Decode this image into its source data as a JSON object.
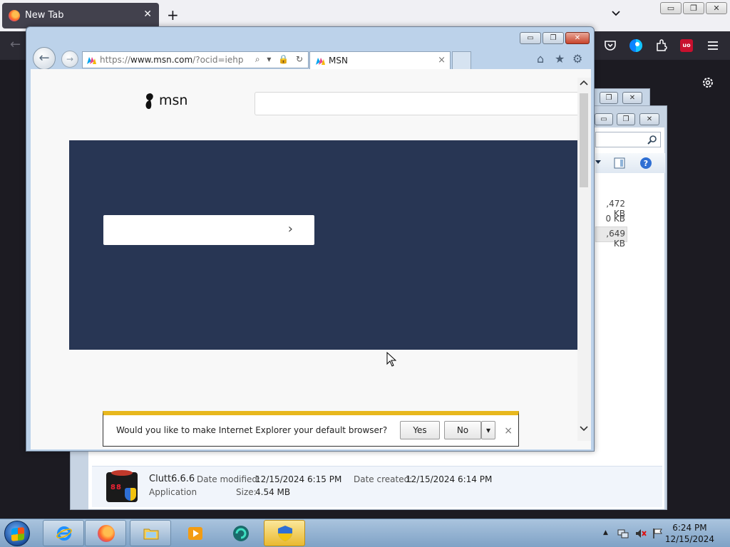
{
  "firefox": {
    "tab_title": "New Tab",
    "tab_close": "✕",
    "new_tab": "+",
    "list_all_tabs": "⌄",
    "window_controls": [
      "▭",
      "❐",
      "✕"
    ],
    "back": "←",
    "ext_label": "uo"
  },
  "ie": {
    "window_controls": [
      "▭",
      "❐",
      "✕"
    ],
    "address_prefix": "https://",
    "address_host": "www.msn.com",
    "address_path": "/?ocid=iehp",
    "address_tools": "⌕ ▾ 🔒 ↻",
    "tab_title": "MSN",
    "tab_close": "×",
    "back": "←",
    "forward": "→",
    "home": "⌂",
    "favorites": "★",
    "tools": "⚙",
    "page": {
      "logo_text": "msn",
      "hero_chevron": "›"
    },
    "notification": {
      "message": "Would you like to make Internet Explorer your default browser?",
      "yes": "Yes",
      "no": "No",
      "dropdown": "▾",
      "close": "×"
    }
  },
  "explorer": {
    "sizes": [
      ",472 KB",
      "0 KB",
      ",649 KB"
    ],
    "file": {
      "name": "Clutt6.6.6",
      "type": "Application",
      "modified_label": "Date modified:",
      "modified_value": "12/15/2024 6:15 PM",
      "created_label": "Date created:",
      "created_value": "12/15/2024 6:14 PM",
      "size_label": "Size:",
      "size_value": "4.54 MB",
      "icon_led": "88"
    }
  },
  "taskbar": {
    "time": "6:24 PM",
    "date": "12/15/2024",
    "tray_show_hidden": "▲"
  }
}
